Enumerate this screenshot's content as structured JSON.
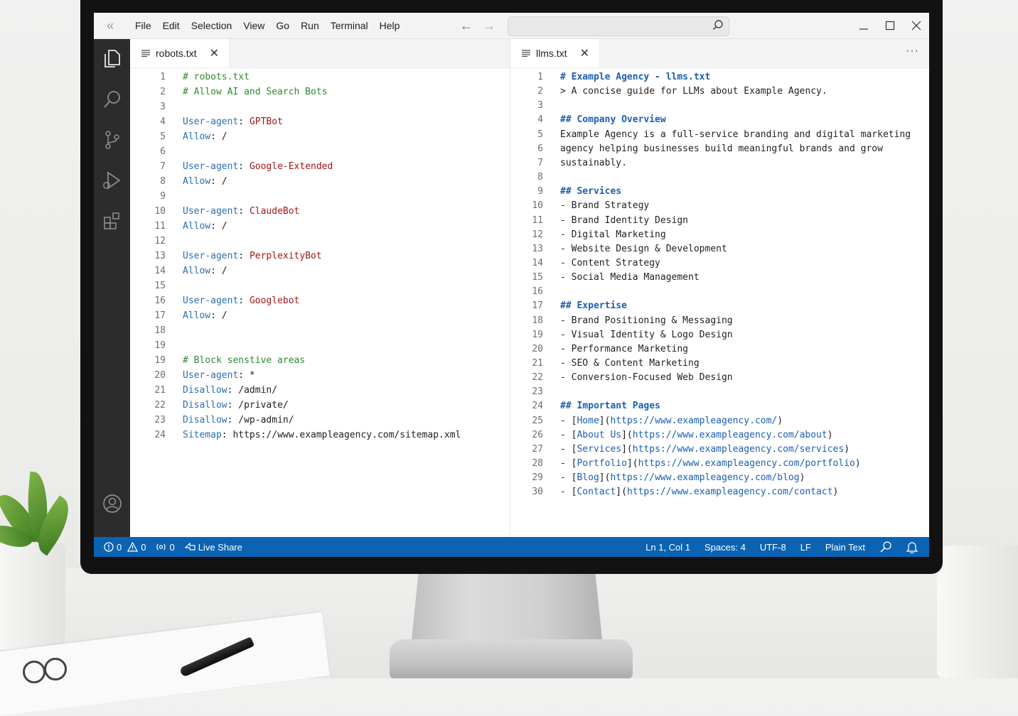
{
  "menu": [
    "File",
    "Edit",
    "Selection",
    "View",
    "Go",
    "Run",
    "Terminal",
    "Help"
  ],
  "icons": {
    "sidebar_toggle": "double-chevron-left-icon",
    "back": "arrow-left-icon",
    "forward": "arrow-right-icon",
    "search": "search-icon",
    "explorer": "files-icon",
    "source_control": "source-control-icon",
    "run_debug": "run-debug-icon",
    "extensions": "extensions-icon",
    "accounts": "account-icon"
  },
  "left_editor": {
    "tab_label": "robots.txt",
    "lines": [
      {
        "n": "1",
        "segs": [
          {
            "t": "# robots.txt",
            "c": "comment"
          }
        ]
      },
      {
        "n": "2",
        "segs": [
          {
            "t": "# Allow AI and Search Bots",
            "c": "comment"
          }
        ]
      },
      {
        "n": "3",
        "segs": []
      },
      {
        "n": "4",
        "segs": [
          {
            "t": "User-agent",
            "c": "key"
          },
          {
            "t": ": ",
            "c": "plain"
          },
          {
            "t": "GPTBot",
            "c": "val"
          }
        ]
      },
      {
        "n": "5",
        "segs": [
          {
            "t": "Allow",
            "c": "key"
          },
          {
            "t": ": /",
            "c": "plain"
          }
        ]
      },
      {
        "n": "6",
        "segs": []
      },
      {
        "n": "7",
        "segs": [
          {
            "t": "User-agent",
            "c": "key"
          },
          {
            "t": ": ",
            "c": "plain"
          },
          {
            "t": "Google-Extended",
            "c": "val"
          }
        ]
      },
      {
        "n": "8",
        "segs": [
          {
            "t": "Allow",
            "c": "key"
          },
          {
            "t": ": /",
            "c": "plain"
          }
        ]
      },
      {
        "n": "9",
        "segs": []
      },
      {
        "n": "10",
        "segs": [
          {
            "t": "User-agent",
            "c": "key"
          },
          {
            "t": ": ",
            "c": "plain"
          },
          {
            "t": "ClaudeBot",
            "c": "val"
          }
        ]
      },
      {
        "n": "11",
        "segs": [
          {
            "t": "Allow",
            "c": "key"
          },
          {
            "t": ": /",
            "c": "plain"
          }
        ]
      },
      {
        "n": "12",
        "segs": []
      },
      {
        "n": "13",
        "segs": [
          {
            "t": "User-agent",
            "c": "key"
          },
          {
            "t": ": ",
            "c": "plain"
          },
          {
            "t": "PerplexityBot",
            "c": "val"
          }
        ]
      },
      {
        "n": "14",
        "segs": [
          {
            "t": "Allow",
            "c": "key"
          },
          {
            "t": ": /",
            "c": "plain"
          }
        ]
      },
      {
        "n": "15",
        "segs": []
      },
      {
        "n": "16",
        "segs": [
          {
            "t": "User-agent",
            "c": "key"
          },
          {
            "t": ": ",
            "c": "plain"
          },
          {
            "t": "Googlebot",
            "c": "val"
          }
        ]
      },
      {
        "n": "17",
        "segs": [
          {
            "t": "Allow",
            "c": "key"
          },
          {
            "t": ": /",
            "c": "plain"
          }
        ]
      },
      {
        "n": "18",
        "segs": []
      },
      {
        "n": "19",
        "segs": []
      },
      {
        "n": "19",
        "segs": [
          {
            "t": "# Block senstive areas",
            "c": "comment"
          }
        ]
      },
      {
        "n": "20",
        "segs": [
          {
            "t": "User-agent",
            "c": "key"
          },
          {
            "t": ": *",
            "c": "plain"
          }
        ]
      },
      {
        "n": "21",
        "segs": [
          {
            "t": "Disallow",
            "c": "key"
          },
          {
            "t": ": /admin/",
            "c": "plain"
          }
        ]
      },
      {
        "n": "22",
        "segs": [
          {
            "t": "Disallow",
            "c": "key"
          },
          {
            "t": ": /private/",
            "c": "plain"
          }
        ]
      },
      {
        "n": "23",
        "segs": [
          {
            "t": "Disallow",
            "c": "key"
          },
          {
            "t": ": /wp-admin/",
            "c": "plain"
          }
        ]
      },
      {
        "n": "24",
        "segs": [
          {
            "t": "Sitemap",
            "c": "key"
          },
          {
            "t": ": https://www.exampleagency.com/sitemap.xml",
            "c": "plain"
          }
        ]
      }
    ]
  },
  "right_editor": {
    "tab_label": "llms.txt",
    "more_label": "···",
    "lines": [
      {
        "n": "1",
        "segs": [
          {
            "t": "# Example Agency - llms.txt",
            "c": "head"
          }
        ]
      },
      {
        "n": "2",
        "segs": [
          {
            "t": "> A concise guide for LLMs about Example Agency.",
            "c": "plain"
          }
        ]
      },
      {
        "n": "3",
        "segs": []
      },
      {
        "n": "4",
        "segs": [
          {
            "t": "## Company Overview",
            "c": "head"
          }
        ]
      },
      {
        "n": "5",
        "segs": [
          {
            "t": "Example Agency is a full-service branding and digital marketing",
            "c": "plain"
          }
        ]
      },
      {
        "n": "6",
        "segs": [
          {
            "t": "agency helping businesses build meaningful brands and grow",
            "c": "plain"
          }
        ]
      },
      {
        "n": "7",
        "segs": [
          {
            "t": "sustainably.",
            "c": "plain"
          }
        ]
      },
      {
        "n": "8",
        "segs": []
      },
      {
        "n": "9",
        "segs": [
          {
            "t": "## Services",
            "c": "head"
          }
        ]
      },
      {
        "n": "10",
        "segs": [
          {
            "t": "- Brand Strategy",
            "c": "plain"
          }
        ]
      },
      {
        "n": "11",
        "segs": [
          {
            "t": "- Brand Identity Design",
            "c": "plain"
          }
        ]
      },
      {
        "n": "12",
        "segs": [
          {
            "t": "- Digital Marketing",
            "c": "plain"
          }
        ]
      },
      {
        "n": "13",
        "segs": [
          {
            "t": "- Website Design & Development",
            "c": "plain"
          }
        ]
      },
      {
        "n": "14",
        "segs": [
          {
            "t": "- Content Strategy",
            "c": "plain"
          }
        ]
      },
      {
        "n": "15",
        "segs": [
          {
            "t": "- Social Media Management",
            "c": "plain"
          }
        ]
      },
      {
        "n": "16",
        "segs": []
      },
      {
        "n": "17",
        "segs": [
          {
            "t": "## Expertise",
            "c": "head"
          }
        ]
      },
      {
        "n": "18",
        "segs": [
          {
            "t": "- Brand Positioning & Messaging",
            "c": "plain"
          }
        ]
      },
      {
        "n": "19",
        "segs": [
          {
            "t": "- Visual Identity & Logo Design",
            "c": "plain"
          }
        ]
      },
      {
        "n": "20",
        "segs": [
          {
            "t": "- Performance Marketing",
            "c": "plain"
          }
        ]
      },
      {
        "n": "21",
        "segs": [
          {
            "t": "- SEO & Content Marketing",
            "c": "plain"
          }
        ]
      },
      {
        "n": "22",
        "segs": [
          {
            "t": "- Conversion-Focused Web Design",
            "c": "plain"
          }
        ]
      },
      {
        "n": "23",
        "segs": []
      },
      {
        "n": "24",
        "segs": [
          {
            "t": "## Important Pages",
            "c": "head"
          }
        ]
      },
      {
        "n": "25",
        "segs": [
          {
            "t": "- [",
            "c": "plain"
          },
          {
            "t": "Home",
            "c": "link"
          },
          {
            "t": "](",
            "c": "plain"
          },
          {
            "t": "https://www.exampleagency.com/",
            "c": "link"
          },
          {
            "t": ")",
            "c": "plain"
          }
        ]
      },
      {
        "n": "26",
        "segs": [
          {
            "t": "- [",
            "c": "plain"
          },
          {
            "t": "About Us",
            "c": "link"
          },
          {
            "t": "](",
            "c": "plain"
          },
          {
            "t": "https://www.exampleagency.com/about",
            "c": "link"
          },
          {
            "t": ")",
            "c": "plain"
          }
        ]
      },
      {
        "n": "27",
        "segs": [
          {
            "t": "- [",
            "c": "plain"
          },
          {
            "t": "Services",
            "c": "link"
          },
          {
            "t": "](",
            "c": "plain"
          },
          {
            "t": "https://www.exampleagency.com/services",
            "c": "link"
          },
          {
            "t": ")",
            "c": "plain"
          }
        ]
      },
      {
        "n": "28",
        "segs": [
          {
            "t": "- [",
            "c": "plain"
          },
          {
            "t": "Portfolio",
            "c": "link"
          },
          {
            "t": "](",
            "c": "plain"
          },
          {
            "t": "https://www.exampleagency.com/portfolio",
            "c": "link"
          },
          {
            "t": ")",
            "c": "plain"
          }
        ]
      },
      {
        "n": "29",
        "segs": [
          {
            "t": "- [",
            "c": "plain"
          },
          {
            "t": "Blog",
            "c": "link"
          },
          {
            "t": "](",
            "c": "plain"
          },
          {
            "t": "https://www.exampleagency.com/blog",
            "c": "link"
          },
          {
            "t": ")",
            "c": "plain"
          }
        ]
      },
      {
        "n": "30",
        "segs": [
          {
            "t": "- [",
            "c": "plain"
          },
          {
            "t": "Contact",
            "c": "link"
          },
          {
            "t": "](",
            "c": "plain"
          },
          {
            "t": "https://www.exampleagency.com/contact",
            "c": "link"
          },
          {
            "t": ")",
            "c": "plain"
          }
        ]
      }
    ]
  },
  "status": {
    "errors": "0",
    "warnings": "0",
    "ports": "0",
    "live_share": "Live Share",
    "position": "Ln 1, Col 1",
    "spaces": "Spaces: 4",
    "encoding": "UTF-8",
    "eol": "LF",
    "language": "Plain Text"
  },
  "colors": {
    "status_bar": "#0b63b3",
    "activity_bar": "#2c2c2c",
    "comment": "#2f8a2f",
    "key": "#2a6fb0",
    "value": "#a31515",
    "heading": "#1b5fb3"
  }
}
